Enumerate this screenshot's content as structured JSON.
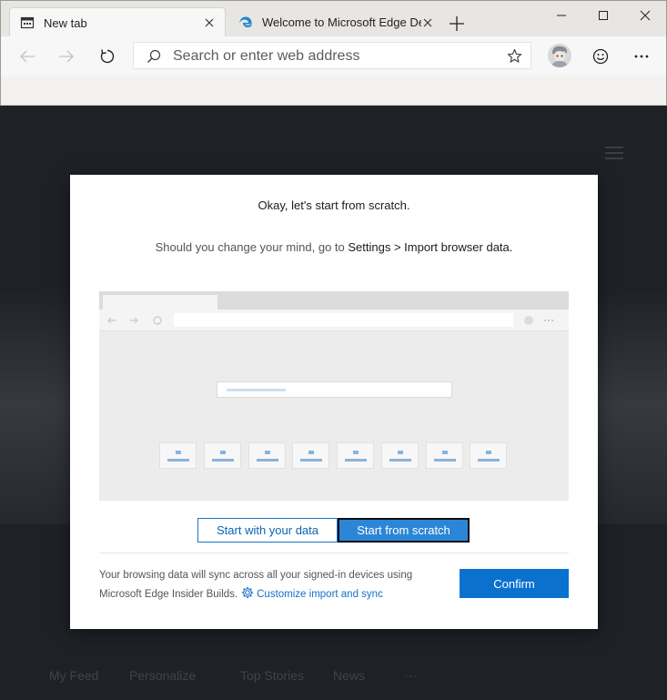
{
  "tabs": [
    {
      "label": "New tab",
      "icon": "new-tab-page-icon",
      "active": true
    },
    {
      "label": "Welcome to Microsoft Edge Dev",
      "icon": "edge-logo-icon",
      "active": false
    }
  ],
  "address": {
    "placeholder": "Search or enter web address"
  },
  "dialog": {
    "title": "Okay, let's start from scratch.",
    "sub_prefix": "Should you change your mind, go to ",
    "sub_path": "Settings > Import browser data.",
    "option_data": "Start with your data",
    "option_scratch": "Start from scratch",
    "footer_text": "Your browsing data will sync across all your signed-in devices using Microsoft Edge Insider Builds.",
    "footer_link": "Customize import and sync",
    "confirm": "Confirm"
  },
  "feed_tabs": [
    "My Feed",
    "Personalize",
    "Top Stories",
    "News",
    "···"
  ],
  "colors": {
    "accent": "#0a72ce",
    "link": "#1570c5",
    "selected_option": "#2b86d8"
  }
}
